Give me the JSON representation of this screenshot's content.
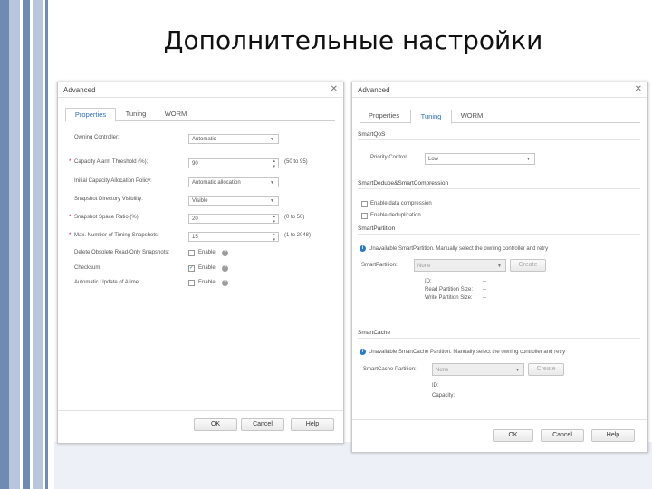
{
  "slide": {
    "title": "Дополнительные настройки"
  },
  "colors": {
    "stripe_dark": "#6f8ab3",
    "stripe_light": "#b7c6dc",
    "info_blue": "#2f7bc1"
  },
  "left_dialog": {
    "title": "Advanced",
    "tabs": [
      "Properties",
      "Tuning",
      "WORM"
    ],
    "active_tab": "Properties",
    "fields": {
      "owning_controller": {
        "label": "Owning Controller:",
        "value": "Automatic"
      },
      "capacity_threshold": {
        "label": "Capacity Alarm Threshold (%):",
        "value": "90",
        "range": "(50 to 95)"
      },
      "initial_allocation": {
        "label": "Initial Capacity Allocation Policy:",
        "value": "Automatic allocation"
      },
      "snapshot_visibility": {
        "label": "Snapshot Directory Visibility:",
        "value": "Visible"
      },
      "snapshot_ratio": {
        "label": "Snapshot Space Ratio (%):",
        "value": "20",
        "range": "(0 to 50)"
      },
      "max_snapshots": {
        "label": "Max. Number of Timing Snapshots:",
        "value": "15",
        "range": "(1 to 2048)"
      },
      "delete_obsolete": {
        "label": "Delete Obsolete Read-Only Snapshots:",
        "value": "Enable"
      },
      "checksum": {
        "label": "Checksum:",
        "value": "Enable"
      },
      "auto_update_atime": {
        "label": "Automatic Update of Atime:",
        "value": "Enable"
      }
    },
    "buttons": {
      "ok": "OK",
      "cancel": "Cancel",
      "help": "Help"
    }
  },
  "right_dialog": {
    "title": "Advanced",
    "tabs": [
      "Properties",
      "Tuning",
      "WORM"
    ],
    "active_tab": "Tuning",
    "smartqos": {
      "heading": "SmartQoS",
      "label": "Priority Control:",
      "value": "Low"
    },
    "dedupe": {
      "heading": "SmartDedupe&SmartCompression",
      "compression": "Enable data compression",
      "dedup": "Enable deduplication"
    },
    "partition": {
      "heading": "SmartPartition",
      "notice": "Unavailable SmartPartition. Manually select the owning controller and retry",
      "label": "SmartPartition:",
      "value": "None",
      "create": "Create",
      "details": [
        {
          "key": "ID:",
          "val": "--"
        },
        {
          "key": "Read Partition Size:",
          "val": "--"
        },
        {
          "key": "Write Partition Size:",
          "val": "--"
        }
      ]
    },
    "cache": {
      "heading": "SmartCache",
      "notice": "Unavailable SmartCache Partition. Manually select the owning controller and retry",
      "label": "SmartCache Partition:",
      "value": "None",
      "create": "Create",
      "details": [
        "ID:",
        "Capacity:"
      ]
    },
    "buttons": {
      "ok": "OK",
      "cancel": "Cancel",
      "help": "Help"
    }
  }
}
